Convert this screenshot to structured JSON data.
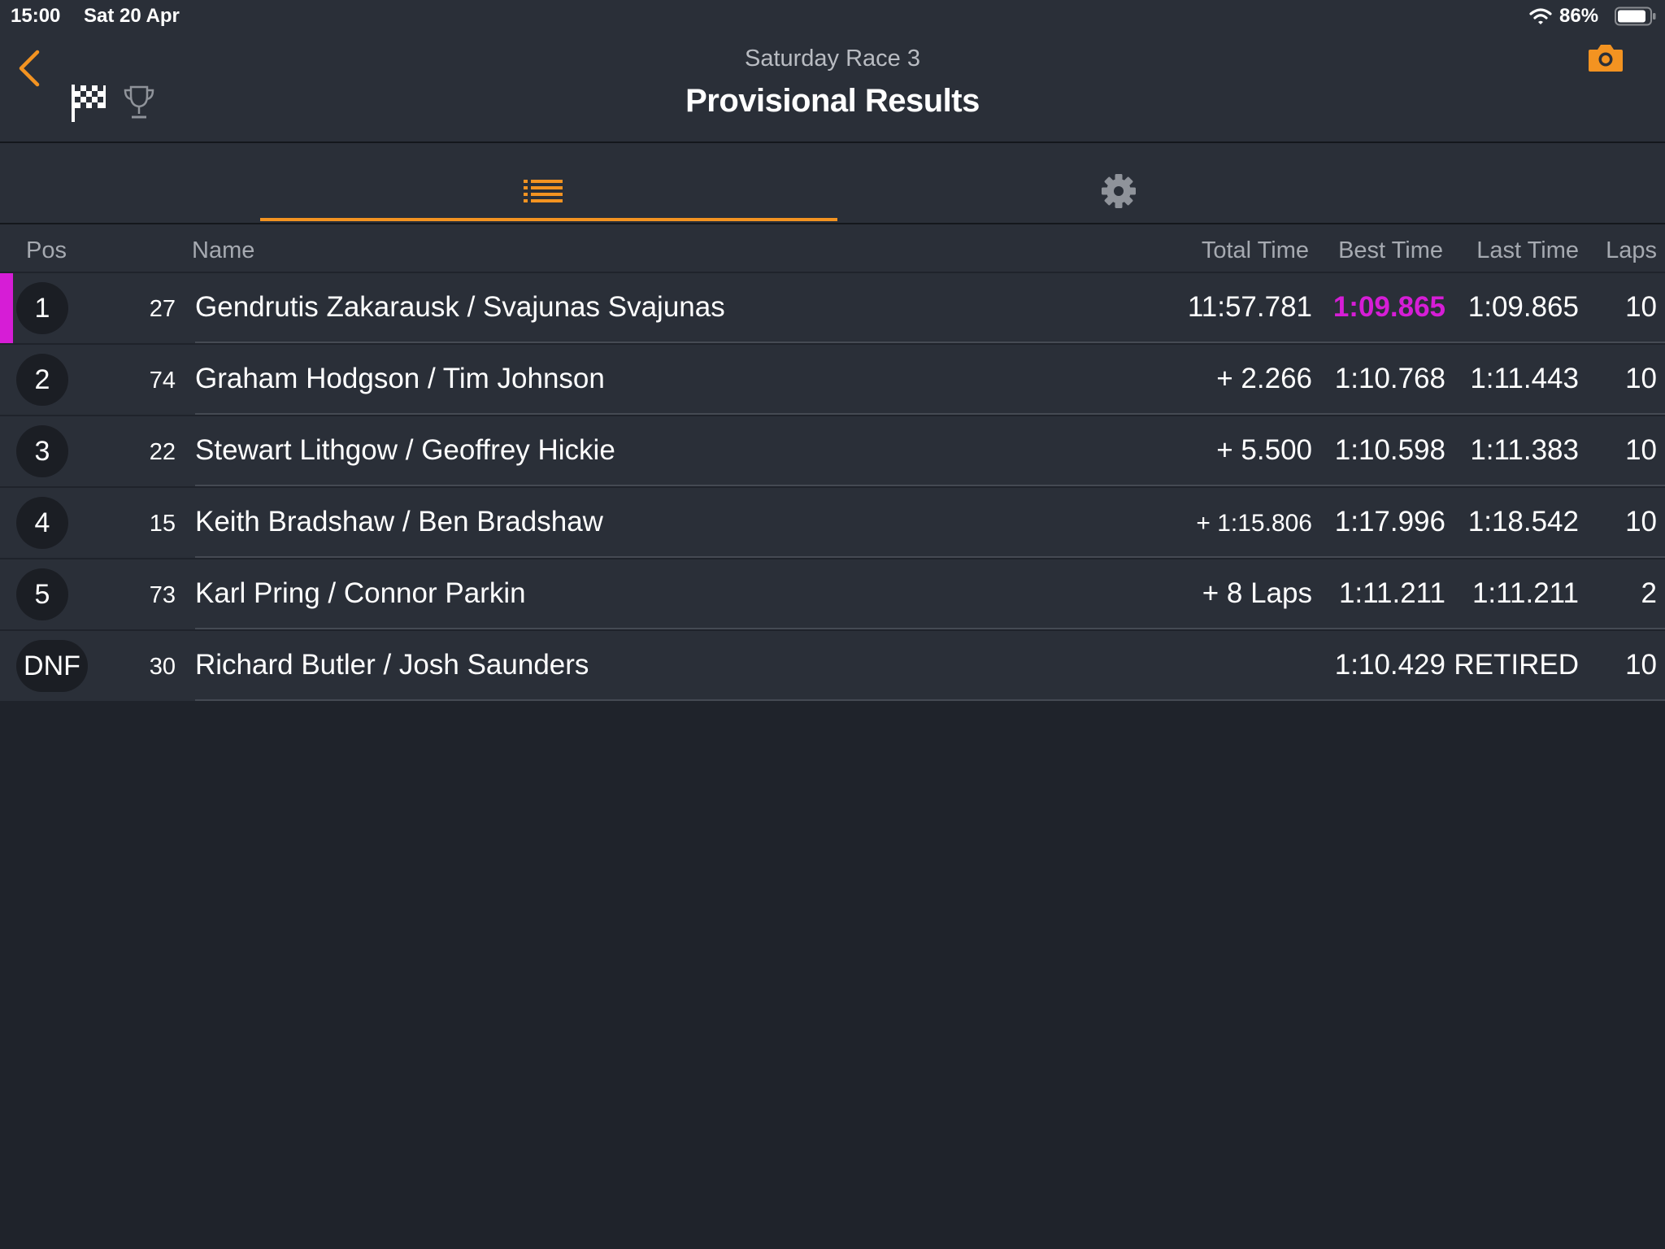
{
  "status_bar": {
    "time": "15:00",
    "date": "Sat 20 Apr",
    "battery": "86%"
  },
  "header": {
    "subtitle": "Saturday Race 3",
    "title": "Provisional Results"
  },
  "icons": {
    "back": "chevron-left-icon",
    "flag": "checkered-flag-icon",
    "trophy": "trophy-icon",
    "camera": "camera-icon",
    "list": "list-icon",
    "settings": "gear-icon"
  },
  "colors": {
    "accent": "#f39321",
    "fastest_lap": "#d61dd6",
    "background": "#1f232b",
    "panel": "#2a2f38"
  },
  "columns": {
    "pos": "Pos",
    "name": "Name",
    "total_time": "Total Time",
    "best_time": "Best Time",
    "last_time": "Last Time",
    "laps": "Laps"
  },
  "results": [
    {
      "pos": "1",
      "number": "27",
      "name": "Gendrutis Zakarausk / Svajunas Svajunas",
      "total_time": "11:57.781",
      "best_time": "1:09.865",
      "last_time": "1:09.865",
      "laps": "10"
    },
    {
      "pos": "2",
      "number": "74",
      "name": "Graham Hodgson / Tim Johnson",
      "total_time": "+ 2.266",
      "best_time": "1:10.768",
      "last_time": "1:11.443",
      "laps": "10"
    },
    {
      "pos": "3",
      "number": "22",
      "name": "Stewart Lithgow / Geoffrey Hickie",
      "total_time": "+ 5.500",
      "best_time": "1:10.598",
      "last_time": "1:11.383",
      "laps": "10"
    },
    {
      "pos": "4",
      "number": "15",
      "name": "Keith Bradshaw / Ben Bradshaw",
      "total_time": "+ 1:15.806",
      "best_time": "1:17.996",
      "last_time": "1:18.542",
      "laps": "10"
    },
    {
      "pos": "5",
      "number": "73",
      "name": "Karl Pring / Connor Parkin",
      "total_time": "+ 8 Laps",
      "best_time": "1:11.211",
      "last_time": "1:11.211",
      "laps": "2"
    },
    {
      "pos": "DNF",
      "number": "30",
      "name": "Richard Butler / Josh Saunders",
      "total_time": "",
      "best_time": "1:10.429",
      "last_time": "RETIRED",
      "laps": "10"
    }
  ]
}
